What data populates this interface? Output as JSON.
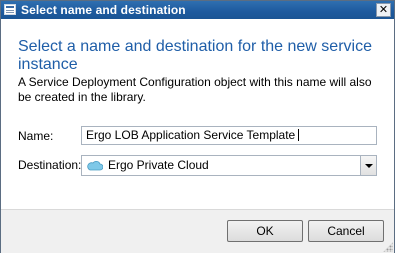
{
  "window": {
    "title": "Select name and destination",
    "close_glyph": "✕"
  },
  "heading": "Select a name and destination for the new service instance",
  "description": "A Service Deployment Configuration object with this name will also be created in the library.",
  "form": {
    "name_label": "Name:",
    "name_value": "Ergo LOB Application Service Template",
    "destination_label": "Destination:",
    "destination_value": "Ergo Private Cloud",
    "destination_icon": "cloud-icon"
  },
  "buttons": {
    "ok": "OK",
    "cancel": "Cancel"
  }
}
